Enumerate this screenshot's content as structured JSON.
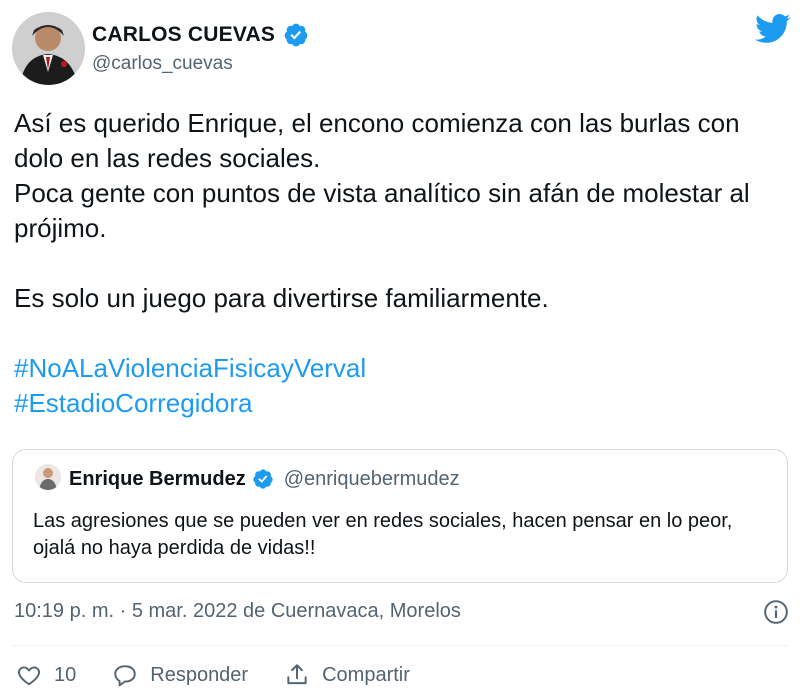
{
  "author": {
    "display_name": "CARLOS CUEVAS",
    "handle": "@carlos_cuevas"
  },
  "tweet": {
    "lines": [
      "Así es querido Enrique, el encono comienza con las burlas con dolo en las redes sociales.",
      "Poca gente con puntos de vista analítico sin afán de molestar al prójimo.",
      "Es solo un juego para divertirse familiarmente."
    ],
    "hashtags": [
      "#NoALaViolenciaFisicayVerval",
      "#EstadioCorregidora"
    ]
  },
  "quoted_tweet": {
    "display_name": "Enrique Bermudez",
    "handle": "@enriquebermudez",
    "text": "Las agresiones que se pueden ver en redes sociales, hacen pensar en lo peor, ojalá no haya  perdida de vidas!!"
  },
  "meta": {
    "timestamp": "10:19 p. m. · 5 mar. 2022 de Cuernavaca, Morelos"
  },
  "actions": {
    "like_count": "10",
    "reply_label": "Responder",
    "share_label": "Compartir"
  },
  "colors": {
    "accent": "#1d9bf0",
    "text": "#0f1419",
    "secondary": "#536471",
    "border": "#cfd9de"
  },
  "icons": [
    "verified-icon",
    "twitter-bird-icon",
    "info-icon",
    "heart-icon",
    "reply-bubble-icon",
    "share-icon"
  ]
}
